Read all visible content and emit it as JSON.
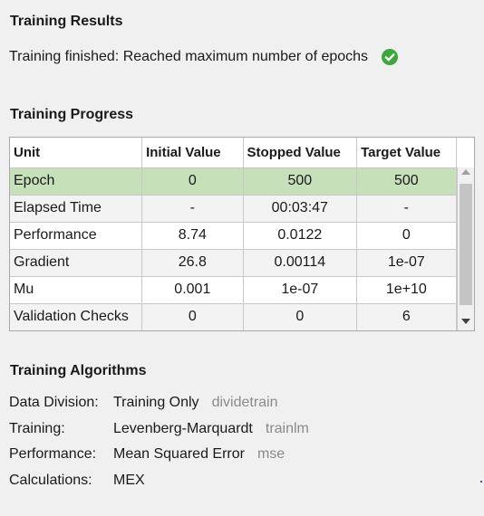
{
  "results": {
    "title": "Training Results",
    "status_text": "Training finished: Reached maximum number of epochs",
    "status_icon": "check-circle-icon",
    "status_color": "#3aa83a"
  },
  "progress": {
    "title": "Training Progress",
    "columns": [
      "Unit",
      "Initial Value",
      "Stopped Value",
      "Target Value"
    ],
    "rows": [
      {
        "unit": "Epoch",
        "initial": "0",
        "stopped": "500",
        "target": "500"
      },
      {
        "unit": "Elapsed Time",
        "initial": "-",
        "stopped": "00:03:47",
        "target": "-"
      },
      {
        "unit": "Performance",
        "initial": "8.74",
        "stopped": "0.0122",
        "target": "0"
      },
      {
        "unit": "Gradient",
        "initial": "26.8",
        "stopped": "0.00114",
        "target": "1e-07"
      },
      {
        "unit": "Mu",
        "initial": "0.001",
        "stopped": "1e-07",
        "target": "1e+10"
      },
      {
        "unit": "Validation Checks",
        "initial": "0",
        "stopped": "0",
        "target": "6"
      }
    ],
    "selected_row_color": "#c6e1b9"
  },
  "algorithms": {
    "title": "Training Algorithms",
    "items": [
      {
        "label": "Data Division:",
        "value": "Training Only",
        "func": "dividetrain"
      },
      {
        "label": "Training:",
        "value": "Levenberg-Marquardt",
        "func": "trainlm"
      },
      {
        "label": "Performance:",
        "value": "Mean Squared Error",
        "func": "mse"
      },
      {
        "label": "Calculations:",
        "value": "MEX",
        "func": ""
      }
    ]
  }
}
